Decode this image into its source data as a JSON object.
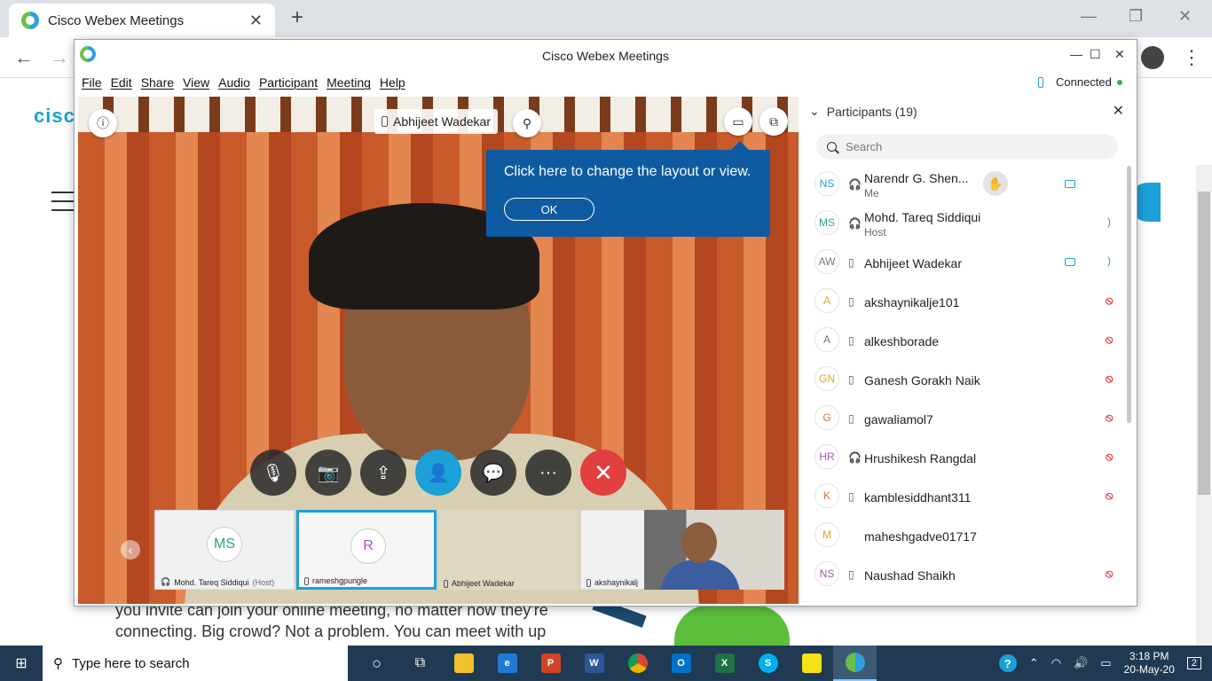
{
  "browser": {
    "tab_title": "Cisco Webex Meetings",
    "tab_close": "✕",
    "new_tab": "+",
    "back": "←",
    "forward": "→",
    "menu": "⋮"
  },
  "page": {
    "logo_text": "cisco",
    "body_text": "you invite can join your online meeting, no matter how they're connecting. Big crowd? Not a problem. You can meet with up"
  },
  "webex": {
    "title": "Cisco Webex Meetings",
    "menu": [
      "File",
      "Edit",
      "Share",
      "View",
      "Audio",
      "Participant",
      "Meeting",
      "Help"
    ],
    "status": "Connected",
    "window_buttons": {
      "minimize": "—",
      "maximize": "☐",
      "close": "✕"
    }
  },
  "stage": {
    "active_speaker": "Abhijeet  Wadekar",
    "tooltip_text": "Click here to change the layout or view.",
    "tooltip_ok": "OK",
    "controls": {
      "mute": "🎙",
      "video": "📷",
      "share": "⇪",
      "participants": "👤",
      "chat": "💬",
      "more": "···",
      "leave": "✕"
    },
    "thumbnails": [
      {
        "initials": "MS",
        "name": "Mohd. Tareq Siddiqui",
        "suffix": "(Host)",
        "color": "#2aa876"
      },
      {
        "initials": "R",
        "name": "rameshgpungle",
        "suffix": "",
        "color": "#a455b8"
      },
      {
        "initials": "",
        "name": "Abhijeet  Wadekar",
        "suffix": "",
        "color": "#333"
      },
      {
        "initials": "",
        "name": "akshaynikalj",
        "suffix": "",
        "color": "#333"
      }
    ],
    "prev": "‹"
  },
  "participants": {
    "header": "Participants (19)",
    "search_placeholder": "Search",
    "list": [
      {
        "initials": "NS",
        "name": "Narendr G. Shen...",
        "sub": "Me",
        "color": "#1ba0d7",
        "device": "headset",
        "status": "video"
      },
      {
        "initials": "MS",
        "name": "Mohd. Tareq Siddiqui",
        "sub": "Host",
        "color": "#2aa876",
        "device": "headset",
        "status": "speak"
      },
      {
        "initials": "AW",
        "name": "Abhijeet  Wadekar",
        "sub": "",
        "color": "#777",
        "device": "phone",
        "status": "video-speak"
      },
      {
        "initials": "A",
        "name": "akshaynikalje101",
        "sub": "",
        "color": "#e8a322",
        "device": "phone",
        "status": "mute"
      },
      {
        "initials": "A",
        "name": "alkeshborade",
        "sub": "",
        "color": "#777",
        "device": "phone",
        "status": "mute"
      },
      {
        "initials": "GN",
        "name": "Ganesh Gorakh Naik",
        "sub": "",
        "color": "#e8a322",
        "device": "phone",
        "status": "mute"
      },
      {
        "initials": "G",
        "name": "gawaliamol7",
        "sub": "",
        "color": "#e0703a",
        "device": "phone",
        "status": "mute"
      },
      {
        "initials": "HR",
        "name": "Hrushikesh Rangdal",
        "sub": "",
        "color": "#a455b8",
        "device": "headset",
        "status": "mute"
      },
      {
        "initials": "K",
        "name": "kamblesiddhant311",
        "sub": "",
        "color": "#e0703a",
        "device": "phone",
        "status": "mute"
      },
      {
        "initials": "M",
        "name": "maheshgadve01717",
        "sub": "",
        "color": "#e8a322",
        "device": "",
        "status": ""
      },
      {
        "initials": "NS",
        "name": "Naushad Shaikh",
        "sub": "",
        "color": "#a455b8",
        "device": "phone",
        "status": "mute"
      }
    ]
  },
  "taskbar": {
    "search_text": "Type here to search",
    "time": "3:18 PM",
    "date": "20-May-20",
    "notifications": "2",
    "apps": [
      {
        "name": "cortana",
        "label": "○",
        "color": "transparent"
      },
      {
        "name": "task-view",
        "label": "⧉",
        "color": "transparent"
      },
      {
        "name": "file-explorer",
        "label": "",
        "color": "#f2c12e"
      },
      {
        "name": "edge",
        "label": "e",
        "color": "#1f7ad6"
      },
      {
        "name": "powerpoint",
        "label": "P",
        "color": "#d04423"
      },
      {
        "name": "word",
        "label": "W",
        "color": "#2b5797"
      },
      {
        "name": "chrome",
        "label": "",
        "color": "#db4437"
      },
      {
        "name": "outlook",
        "label": "O",
        "color": "#0072c6"
      },
      {
        "name": "excel",
        "label": "X",
        "color": "#1e7145"
      },
      {
        "name": "skype",
        "label": "S",
        "color": "#00aff0"
      },
      {
        "name": "sticky-notes",
        "label": "",
        "color": "#f7e018"
      },
      {
        "name": "webex",
        "label": "",
        "color": "#2ea1d8"
      }
    ]
  }
}
